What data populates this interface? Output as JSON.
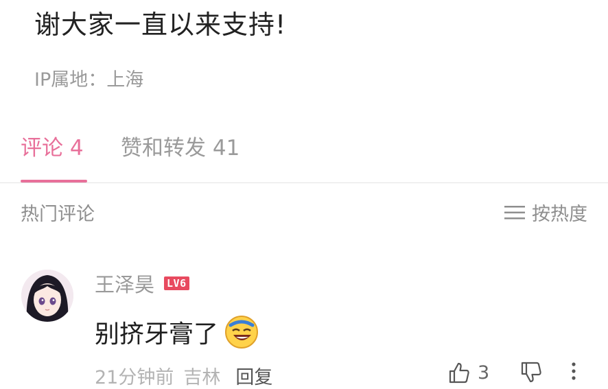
{
  "post": {
    "text": "谢大家一直以来支持!",
    "ip_location": "IP属地：上海"
  },
  "tabs": {
    "comments": "评论 4",
    "likes_reposts": "赞和转发 41"
  },
  "comments_header": {
    "title": "热门评论",
    "sort_label": "按热度"
  },
  "comment": {
    "username": "王泽昊",
    "level": "LV6",
    "text": "别挤牙膏了",
    "time": "21分钟前",
    "location": "吉林",
    "reply_label": "回复",
    "like_count": "3"
  },
  "colors": {
    "accent": "#e8709a",
    "level_badge": "#e84a5f"
  }
}
